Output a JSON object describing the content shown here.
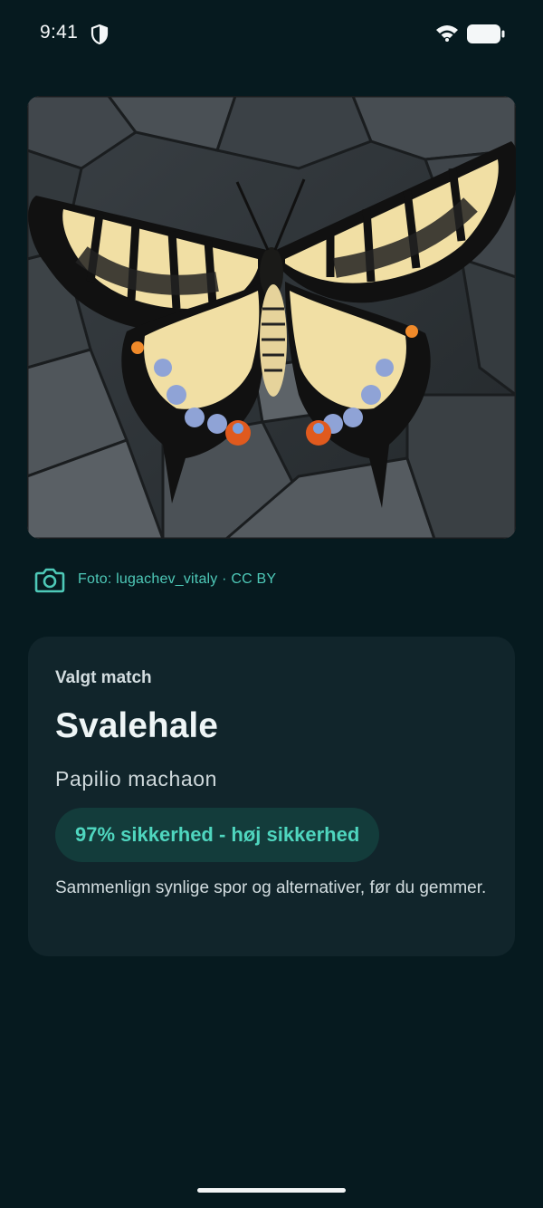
{
  "status_bar": {
    "time": "9:41",
    "icons": [
      "shield-icon",
      "wifi-icon",
      "battery-icon"
    ]
  },
  "photo": {
    "subject_icon": "butterfly-photo",
    "credit_icon": "camera-icon",
    "credit": "Foto: lugachev_vitaly · CC BY"
  },
  "match_card": {
    "label": "Valgt match",
    "common_name": "Svalehale",
    "scientific_name": "Papilio machaon",
    "confidence_badge": "97% sikkerhed - høj sikkerhed",
    "note": "Sammenlign synlige spor og alternativer, før du gemmer."
  },
  "colors": {
    "background": "#061a1f",
    "card": "#11252b",
    "accent": "#4fd6bf",
    "badge_bg": "#133c3b"
  }
}
